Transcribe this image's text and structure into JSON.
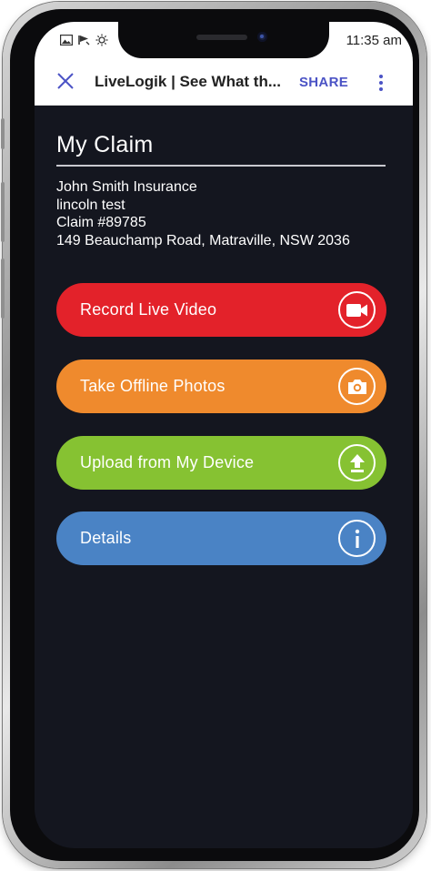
{
  "status_bar": {
    "time": "11:35 am",
    "icons": [
      "image-icon",
      "flag-icon",
      "brightness-icon"
    ]
  },
  "app_bar": {
    "close_icon": "close-icon",
    "title": "LiveLogik | See What th...",
    "share_label": "SHARE",
    "more_icon": "more-vert-icon"
  },
  "claim": {
    "title": "My Claim",
    "insurer": "John Smith Insurance",
    "name": "lincoln test",
    "claim_number": "Claim #89785",
    "address": "149 Beauchamp Road, Matraville, NSW 2036"
  },
  "actions": [
    {
      "label": "Record Live Video",
      "icon": "video-camera-icon",
      "color": "#e3222a"
    },
    {
      "label": "Take Offline Photos",
      "icon": "camera-icon",
      "color": "#ef8a2d"
    },
    {
      "label": "Upload from My Device",
      "icon": "upload-icon",
      "color": "#86c232"
    },
    {
      "label": "Details",
      "icon": "info-icon",
      "color": "#4a83c5"
    }
  ],
  "colors": {
    "background": "#14161f",
    "accent": "#4b53c5"
  }
}
